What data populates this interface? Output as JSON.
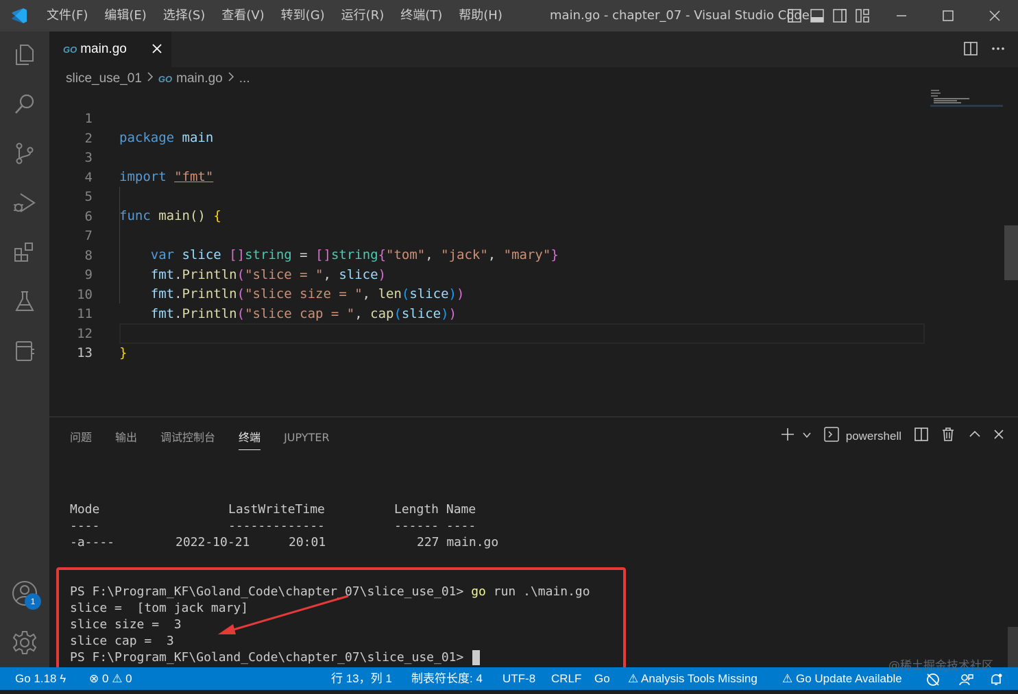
{
  "window": {
    "title": "main.go - chapter_07 - Visual Studio Code",
    "menu": [
      "文件(F)",
      "编辑(E)",
      "选择(S)",
      "查看(V)",
      "转到(G)",
      "运行(R)",
      "终端(T)",
      "帮助(H)"
    ]
  },
  "activity_bar": {
    "icons": [
      "explorer-icon",
      "search-icon",
      "source-control-icon",
      "run-debug-icon",
      "extensions-icon",
      "testing-icon",
      "notebook-icon"
    ],
    "accounts_badge": "1"
  },
  "tab": {
    "label": "main.go",
    "go_mark": "GO"
  },
  "breadcrumb": {
    "folder": "slice_use_01",
    "file": "main.go",
    "more": "..."
  },
  "editor": {
    "line_numbers": [
      "1",
      "2",
      "3",
      "4",
      "5",
      "6",
      "7",
      "8",
      "9",
      "10",
      "11",
      "12",
      "13"
    ],
    "active_line": "13",
    "code": {
      "l1_kw": "package",
      "l1_name": " main",
      "l3_kw": "import",
      "l3_str": "\"fmt\"",
      "l5_kw": "func",
      "l5_fn": "main",
      "l5_rest": "() ",
      "l5_brace": "{",
      "l7_var": "var",
      "l7_name": "slice",
      "l7_type": "string",
      "l7_type2": "string",
      "l7_s1": "\"tom\"",
      "l7_s2": "\"jack\"",
      "l7_s3": "\"mary\"",
      "l8_pkg": "fmt",
      "l8_fn": "Println",
      "l8_str": "\"slice = \"",
      "l8_arg": "slice",
      "l9_pkg": "fmt",
      "l9_fn": "Println",
      "l9_str": "\"slice size = \"",
      "l9_call": "len",
      "l9_arg": "slice",
      "l10_pkg": "fmt",
      "l10_fn": "Println",
      "l10_str": "\"slice cap = \"",
      "l10_call": "cap",
      "l10_arg": "slice",
      "l12_brace": "}"
    }
  },
  "panel": {
    "tabs": [
      "问题",
      "输出",
      "调试控制台",
      "终端",
      "JUPYTER"
    ],
    "active_tab": "终端",
    "shell_label": "powershell"
  },
  "terminal": {
    "header_mode": "Mode",
    "header_lwt": "LastWriteTime",
    "header_len_name": "Length Name",
    "dash_mode": "----",
    "dash_lwt": "-------------",
    "dash_len_name": "------ ----",
    "row_mode": "-a----",
    "row_date": "2022-10-21",
    "row_time": "20:01",
    "row_size_name": "227 main.go",
    "prompt1": "PS F:\\Program_KF\\Goland_Code\\chapter_07\\slice_use_01> ",
    "cmd_go": "go",
    "cmd_rest": " run .\\main.go",
    "out1": "slice =  [tom jack mary]",
    "out2": "slice size =  3",
    "out3": "slice cap =  3",
    "prompt2": "PS F:\\Program_KF\\Goland_Code\\chapter_07\\slice_use_01> "
  },
  "status_bar": {
    "go_version": "Go 1.18",
    "errors": "0",
    "warnings": "0",
    "position": "行 13，列 1",
    "tab_size": "制表符长度: 4",
    "encoding": "UTF-8",
    "eol": "CRLF",
    "language": "Go",
    "analysis": "Analysis Tools Missing",
    "update": "Go Update Available"
  },
  "watermark": "@稀土掘金技术社区",
  "colors": {
    "accent": "#007acc",
    "highlight": "#e53a3a"
  }
}
